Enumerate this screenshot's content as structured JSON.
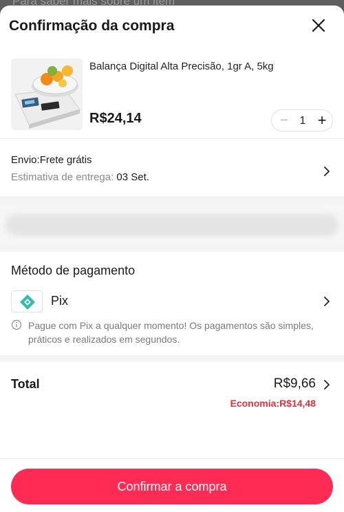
{
  "backdrop": {
    "text": "Para saber mais sobre um item"
  },
  "header": {
    "title": "Confirmação da compra"
  },
  "product": {
    "name": "Balança Digital Alta Precisão, 1gr A, 5kg",
    "price": "R$24,14",
    "quantity": "1",
    "minus_symbol": "−",
    "plus_symbol": "+"
  },
  "shipping": {
    "title": "Envio:Frete grátis",
    "estimate_label": "Estimativa de entrega: ",
    "estimate_date": "03 Set."
  },
  "payment": {
    "title": "Método de pagamento",
    "method": "Pix",
    "note": "Pague com Pix a qualquer momento! Os pagamentos são simples, práticos e realizados em segundos."
  },
  "total": {
    "label": "Total",
    "value": "R$9,66",
    "savings": "Economia:R$14,48"
  },
  "footer": {
    "confirm_label": "Confirmar a compra"
  },
  "colors": {
    "accent": "#fe2c55",
    "savings": "#e0303b",
    "pix": "#32bcad"
  },
  "icons": [
    "close-icon",
    "chevron-right-icon",
    "pix-icon",
    "info-icon",
    "minus-icon",
    "plus-icon"
  ]
}
